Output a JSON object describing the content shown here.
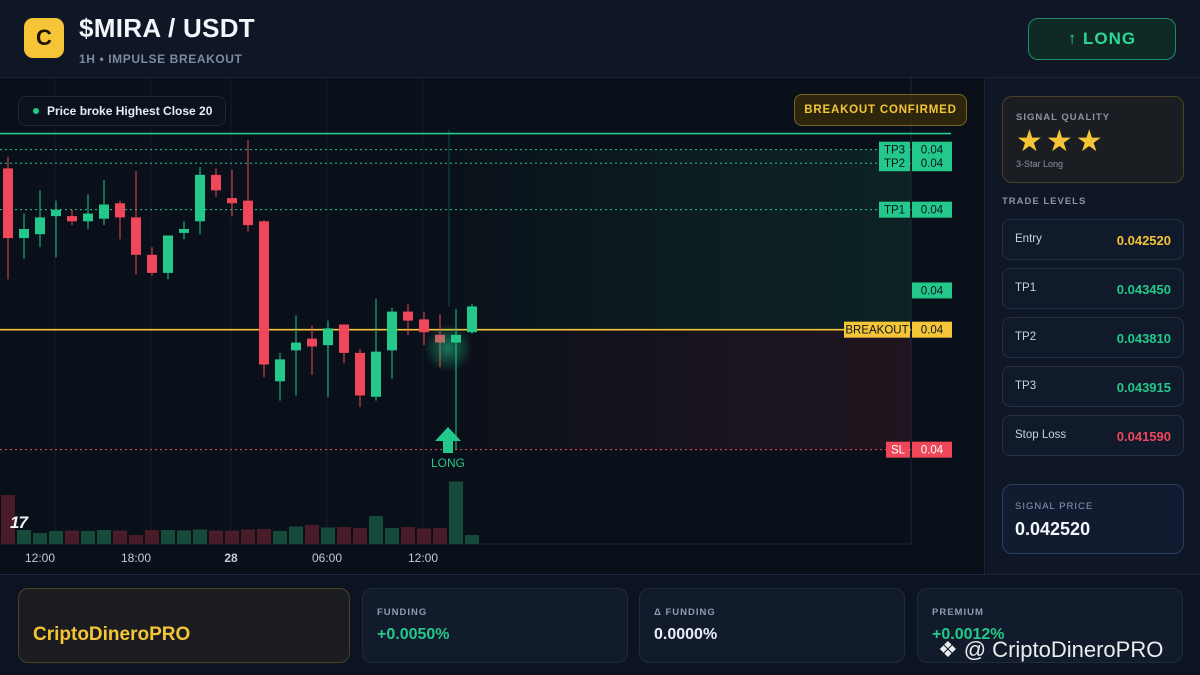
{
  "header": {
    "logo_letter": "C",
    "pair": "$MIRA / USDT",
    "subtitle": "1H • IMPULSE BREAKOUT",
    "long_button": "↑ LONG"
  },
  "chart": {
    "tooltip": "Price broke Highest Close 20",
    "badge": "BREAKOUT CONFIRMED",
    "tv_logo": "17",
    "x_ticks": [
      "12:00",
      "18:00",
      "28",
      "06:00",
      "12:00"
    ],
    "signal_label": "LONG",
    "current_price_label": "0.04",
    "levels": [
      {
        "tag": "TP3",
        "value": "0.04",
        "price": 0.043915,
        "style": "dotted",
        "color": "#22c98a"
      },
      {
        "tag": "TP2",
        "value": "0.04",
        "price": 0.04381,
        "style": "dotted",
        "color": "#22c98a"
      },
      {
        "tag": "TP1",
        "value": "0.04",
        "price": 0.04345,
        "style": "dotted",
        "color": "#22c98a"
      },
      {
        "tag": "BREAKOUT",
        "value": "0.04",
        "price": 0.04252,
        "style": "solid",
        "color": "#f5c537"
      },
      {
        "tag": "SL",
        "value": "0.04",
        "price": 0.04159,
        "style": "dotted",
        "color": "#f0465a"
      }
    ],
    "highest_close_line_price": 0.04404,
    "colors": {
      "up": "#22c98a",
      "down": "#f0465a",
      "breakout": "#f5c537"
    }
  },
  "chart_data": {
    "type": "candlestick",
    "candles": [
      {
        "o": 0.04377,
        "h": 0.04386,
        "c": 0.04323,
        "l": 0.04291
      },
      {
        "o": 0.04323,
        "h": 0.04342,
        "c": 0.0433,
        "l": 0.04307
      },
      {
        "o": 0.04326,
        "h": 0.0436,
        "c": 0.04339,
        "l": 0.04316
      },
      {
        "o": 0.0434,
        "h": 0.04352,
        "c": 0.04345,
        "l": 0.04308
      },
      {
        "o": 0.0434,
        "h": 0.04345,
        "c": 0.04336,
        "l": 0.04333
      },
      {
        "o": 0.04336,
        "h": 0.04357,
        "c": 0.04342,
        "l": 0.0433
      },
      {
        "o": 0.04338,
        "h": 0.04368,
        "c": 0.04349,
        "l": 0.04333
      },
      {
        "o": 0.0435,
        "h": 0.04352,
        "c": 0.04339,
        "l": 0.04322
      },
      {
        "o": 0.04339,
        "h": 0.04375,
        "c": 0.0431,
        "l": 0.04295
      },
      {
        "o": 0.0431,
        "h": 0.04316,
        "c": 0.04296,
        "l": 0.04294
      },
      {
        "o": 0.04296,
        "h": 0.04322,
        "c": 0.04325,
        "l": 0.04291
      },
      {
        "o": 0.04327,
        "h": 0.04336,
        "c": 0.0433,
        "l": 0.04322
      },
      {
        "o": 0.04336,
        "h": 0.04378,
        "c": 0.04372,
        "l": 0.04326
      },
      {
        "o": 0.04372,
        "h": 0.04377,
        "c": 0.0436,
        "l": 0.04355
      },
      {
        "o": 0.04354,
        "h": 0.04376,
        "c": 0.0435,
        "l": 0.0434
      },
      {
        "o": 0.04352,
        "h": 0.04399,
        "c": 0.04333,
        "l": 0.04328
      },
      {
        "o": 0.04336,
        "h": 0.04337,
        "c": 0.04225,
        "l": 0.04215
      },
      {
        "o": 0.04212,
        "h": 0.04234,
        "c": 0.04229,
        "l": 0.04197
      },
      {
        "o": 0.04236,
        "h": 0.04263,
        "c": 0.04242,
        "l": 0.04201
      },
      {
        "o": 0.04245,
        "h": 0.04255,
        "c": 0.04239,
        "l": 0.04217
      },
      {
        "o": 0.0424,
        "h": 0.04259,
        "c": 0.04253,
        "l": 0.042
      },
      {
        "o": 0.04256,
        "h": 0.04256,
        "c": 0.04234,
        "l": 0.04226
      },
      {
        "o": 0.04234,
        "h": 0.04237,
        "c": 0.04201,
        "l": 0.04192
      },
      {
        "o": 0.042,
        "h": 0.04276,
        "c": 0.04235,
        "l": 0.04197
      },
      {
        "o": 0.04236,
        "h": 0.04269,
        "c": 0.04266,
        "l": 0.04214
      },
      {
        "o": 0.04266,
        "h": 0.04272,
        "c": 0.04259,
        "l": 0.04248
      },
      {
        "o": 0.0426,
        "h": 0.04266,
        "c": 0.0425,
        "l": 0.0424
      },
      {
        "o": 0.04248,
        "h": 0.04264,
        "c": 0.04242,
        "l": 0.04223
      },
      {
        "o": 0.04242,
        "h": 0.04268,
        "c": 0.04248,
        "l": 0.04159
      },
      {
        "o": 0.0425,
        "h": 0.04272,
        "c": 0.0427,
        "l": 0.04249
      }
    ],
    "volumes": [
      0.98,
      0.28,
      0.22,
      0.26,
      0.27,
      0.26,
      0.28,
      0.27,
      0.18,
      0.28,
      0.28,
      0.27,
      0.29,
      0.27,
      0.27,
      0.29,
      0.3,
      0.26,
      0.35,
      0.38,
      0.33,
      0.34,
      0.32,
      0.56,
      0.32,
      0.34,
      0.31,
      0.32,
      1.25,
      0.18
    ],
    "ylim": [
      0.0412,
      0.0443
    ]
  },
  "panel": {
    "signal_quality_title": "SIGNAL QUALITY",
    "stars": "★★★",
    "stars_value": 3,
    "stars_label": "3-Star Long",
    "trade_levels_title": "TRADE LEVELS",
    "levels": [
      {
        "name": "Entry",
        "value": "0.042520",
        "color": "#f5c537"
      },
      {
        "name": "TP1",
        "value": "0.043450",
        "color": "#22c98a"
      },
      {
        "name": "TP2",
        "value": "0.043810",
        "color": "#22c98a"
      },
      {
        "name": "TP3",
        "value": "0.043915",
        "color": "#22c98a"
      },
      {
        "name": "Stop Loss",
        "value": "0.041590",
        "color": "#f0465a"
      }
    ],
    "signal_price_title": "SIGNAL PRICE",
    "signal_price": "0.042520"
  },
  "bottom": {
    "brand": "CriptoDineroPRO",
    "stats": [
      {
        "label": "FUNDING",
        "value": "+0.0050%",
        "color": "#22c98a"
      },
      {
        "label": "Δ FUNDING",
        "value": "0.0000%",
        "color": "#e6edf6"
      },
      {
        "label": "PREMIUM",
        "value": "+0.0012%",
        "color": "#22c98a"
      }
    ],
    "watermark": "@ CriptoDineroPRO"
  }
}
